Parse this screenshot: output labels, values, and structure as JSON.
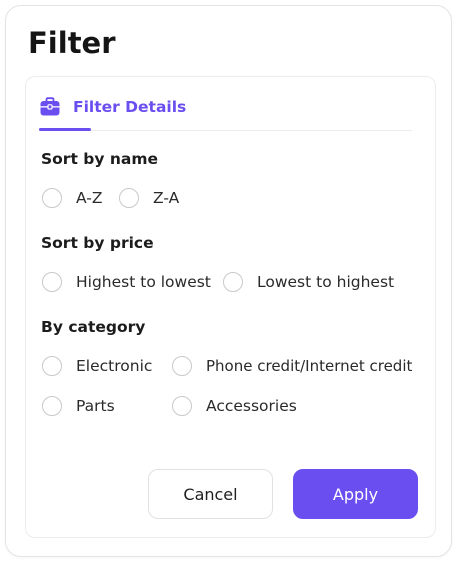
{
  "dialog": {
    "title": "Filter"
  },
  "tab": {
    "label": "Filter Details",
    "icon": "briefcase-icon",
    "accent_color": "#6b4ef0"
  },
  "sections": {
    "sort_name": {
      "title": "Sort by name",
      "options": [
        "A-Z",
        "Z-A"
      ]
    },
    "sort_price": {
      "title": "Sort by price",
      "options": [
        "Highest to lowest",
        "Lowest to highest"
      ]
    },
    "category": {
      "title": "By category",
      "options": [
        "Electronic",
        "Phone credit/Internet credit",
        "Parts",
        "Accessories"
      ]
    }
  },
  "actions": {
    "cancel_label": "Cancel",
    "apply_label": "Apply",
    "apply_color": "#6b4ef0"
  }
}
